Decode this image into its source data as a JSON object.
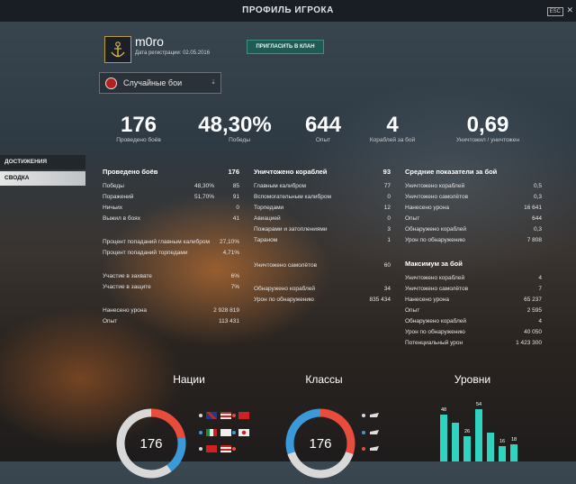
{
  "window": {
    "title": "ПРОФИЛЬ ИГРОКА",
    "esc": "ESC",
    "close": "✕"
  },
  "player": {
    "nickname": "m0ro",
    "reg_date": "Дата регистрации: 02.05.2016",
    "invite_label": "ПРИГЛАСИТЬ В КЛАН"
  },
  "mode_select": {
    "value": "Случайные бои",
    "arrow": "⇣"
  },
  "kpis": [
    {
      "value": "176",
      "label": "Проведено боёв"
    },
    {
      "value": "48,30%",
      "label": "Победы"
    },
    {
      "value": "644",
      "label": "Опыт"
    },
    {
      "value": "4",
      "label": "Кораблей за бой"
    },
    {
      "value": "0,69",
      "label": "Уничтожил / уничтожен"
    }
  ],
  "sidebar": {
    "items": [
      {
        "label": "ДОСТИЖЕНИЯ"
      },
      {
        "label": "СВОДКА"
      }
    ]
  },
  "battles": {
    "header": {
      "label": "Проведено боёв",
      "value": "176"
    },
    "rows": [
      {
        "label": "Победы",
        "pct": "48,30%",
        "value": "85"
      },
      {
        "label": "Поражений",
        "pct": "51,70%",
        "value": "91"
      },
      {
        "label": "Ничьих",
        "pct": "",
        "value": "0"
      },
      {
        "label": "Выжил в боях",
        "pct": "",
        "value": "41"
      }
    ],
    "accuracy": [
      {
        "label": "Процент попаданий главным калибром",
        "value": "27,10%"
      },
      {
        "label": "Процент попаданий торпедами",
        "value": "4,71%"
      }
    ],
    "capture": [
      {
        "label": "Участие в захвате",
        "value": "6%"
      },
      {
        "label": "Участие в защите",
        "value": "7%"
      }
    ],
    "damage": [
      {
        "label": "Нанесено урона",
        "value": "2 928 819"
      },
      {
        "label": "Опыт",
        "value": "113 431"
      }
    ]
  },
  "destroyed": {
    "header": {
      "label": "Уничтожено кораблей",
      "value": "93"
    },
    "rows": [
      {
        "label": "Главным калибром",
        "value": "77"
      },
      {
        "label": "Вспомогательным калибром",
        "value": "0"
      },
      {
        "label": "Торпедами",
        "value": "12"
      },
      {
        "label": "Авиацией",
        "value": "0"
      },
      {
        "label": "Пожарами и затоплениями",
        "value": "3"
      },
      {
        "label": "Тараном",
        "value": "1"
      }
    ],
    "planes": {
      "label": "Уничтожено самолётов",
      "value": "60"
    },
    "spotted": [
      {
        "label": "Обнаружено кораблей",
        "value": "34"
      },
      {
        "label": "Урон по обнаружению",
        "value": "835 434"
      }
    ]
  },
  "averages": {
    "header": "Средние показатели за бой",
    "rows": [
      {
        "label": "Уничтожено кораблей",
        "value": "0,5"
      },
      {
        "label": "Уничтожено самолётов",
        "value": "0,3"
      },
      {
        "label": "Нанесено урона",
        "value": "16 641"
      },
      {
        "label": "Опыт",
        "value": "644"
      },
      {
        "label": "Обнаружено кораблей",
        "value": "0,3"
      },
      {
        "label": "Урон по обнаружению",
        "value": "7 808"
      }
    ]
  },
  "maximum": {
    "header": "Максимум за бой",
    "rows": [
      {
        "label": "Уничтожено кораблей",
        "value": "4"
      },
      {
        "label": "Уничтожено самолётов",
        "value": "7"
      },
      {
        "label": "Нанесено урона",
        "value": "65 237"
      },
      {
        "label": "Опыт",
        "value": "2 595"
      },
      {
        "label": "Обнаружено кораблей",
        "value": "4"
      },
      {
        "label": "Урон по обнаружению",
        "value": "40 050"
      },
      {
        "label": "Потенциальный урон",
        "value": "1 423 300"
      }
    ]
  },
  "charts": {
    "nations": {
      "title": "Нации",
      "total": "176",
      "colors": [
        "#e84c3d",
        "#3a9ad9",
        "#d8d8d8"
      ],
      "shares": [
        0.22,
        0.18,
        0.6
      ]
    },
    "classes": {
      "title": "Классы",
      "total": "176",
      "colors": [
        "#e84c3d",
        "#d8d8d8",
        "#3a9ad9"
      ],
      "shares": [
        0.3,
        0.4,
        0.3
      ]
    },
    "tiers": {
      "title": "Уровни",
      "bars": [
        {
          "label": "48",
          "value": 48
        },
        {
          "label": "",
          "value": 40
        },
        {
          "label": "26",
          "value": 26
        },
        {
          "label": "54",
          "value": 54
        },
        {
          "label": "",
          "value": 30
        },
        {
          "label": "16",
          "value": 16
        },
        {
          "label": "18",
          "value": 18
        }
      ]
    }
  }
}
